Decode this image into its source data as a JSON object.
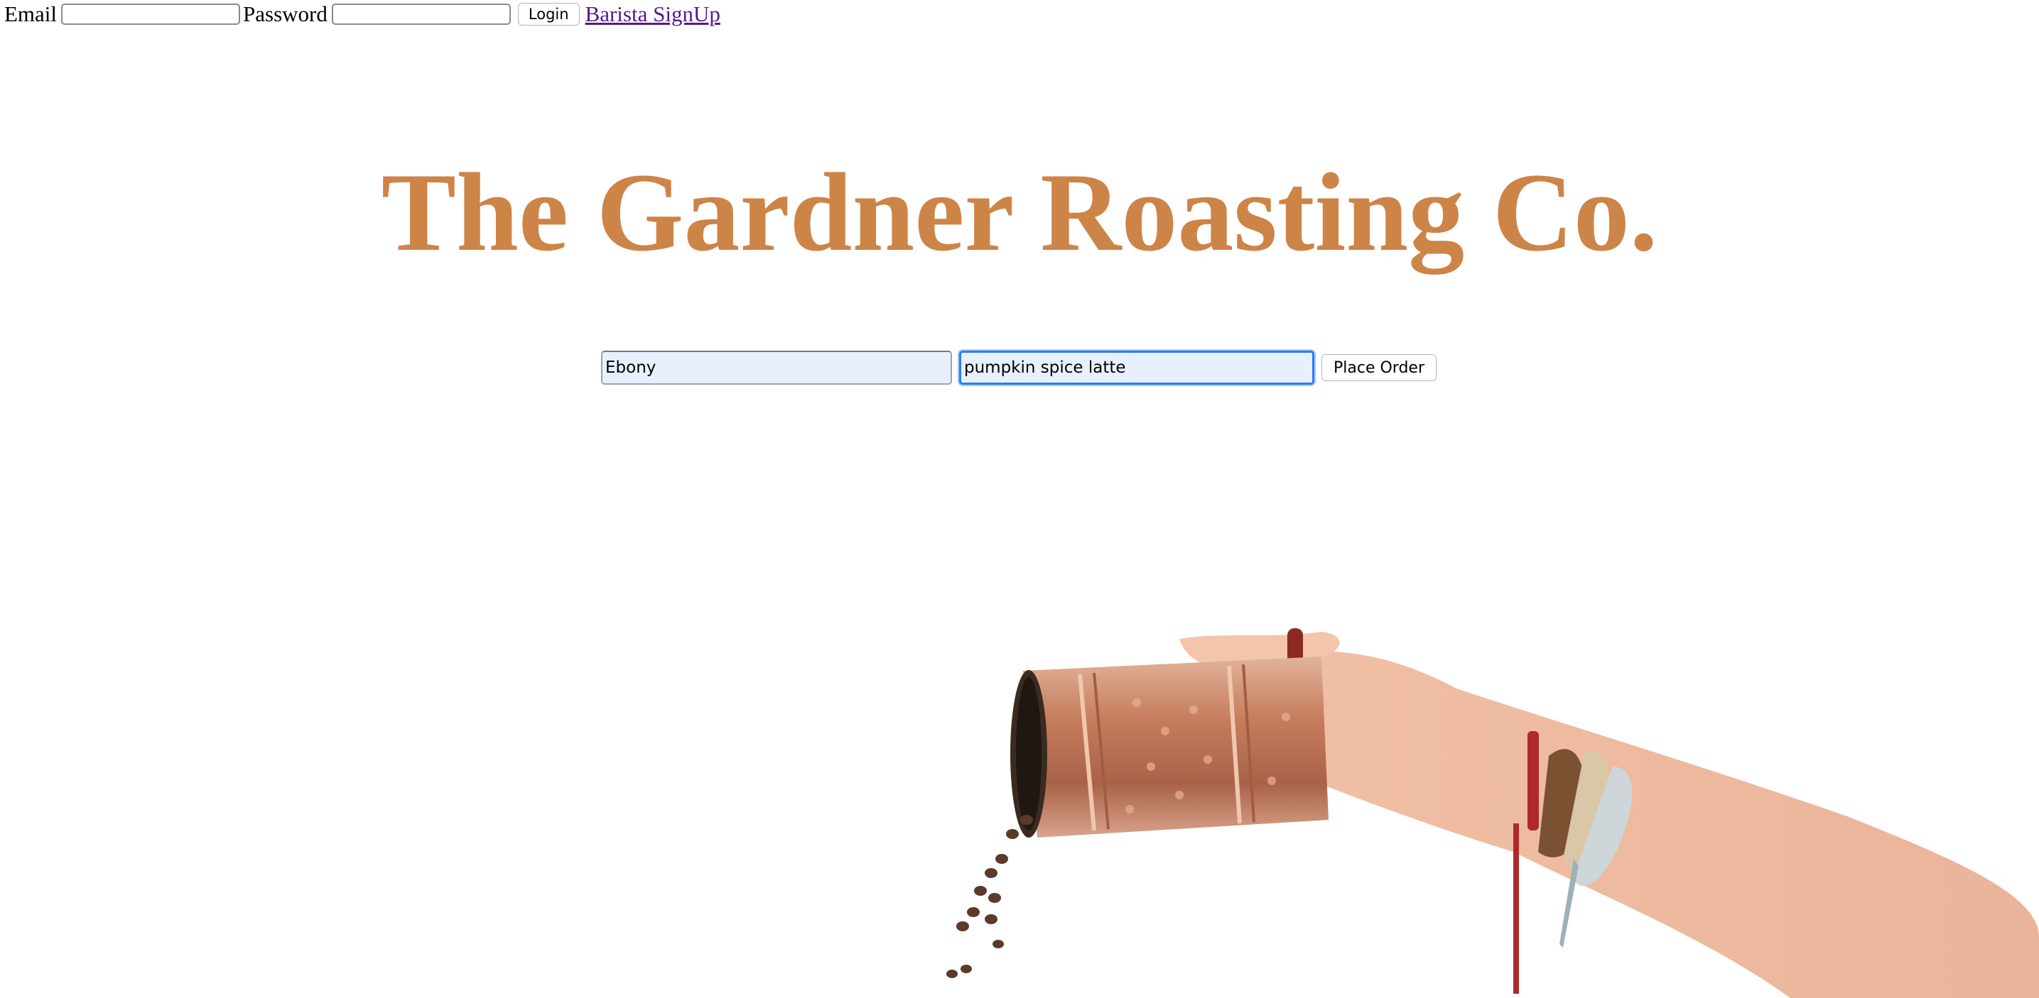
{
  "header": {
    "email_label": "Email",
    "password_label": "Password",
    "login_label": "Login",
    "signup_link": "Barista SignUp"
  },
  "hero": {
    "title": "The Gardner Roasting Co."
  },
  "order_form": {
    "name_value": "Ebony",
    "drink_value": "pumpkin spice latte",
    "submit_label": "Place Order"
  },
  "colors": {
    "title": "#cd8447",
    "link_visited": "#551a8b",
    "autofill_bg": "#e8f0fe",
    "focus_ring": "#2a7cf5"
  }
}
